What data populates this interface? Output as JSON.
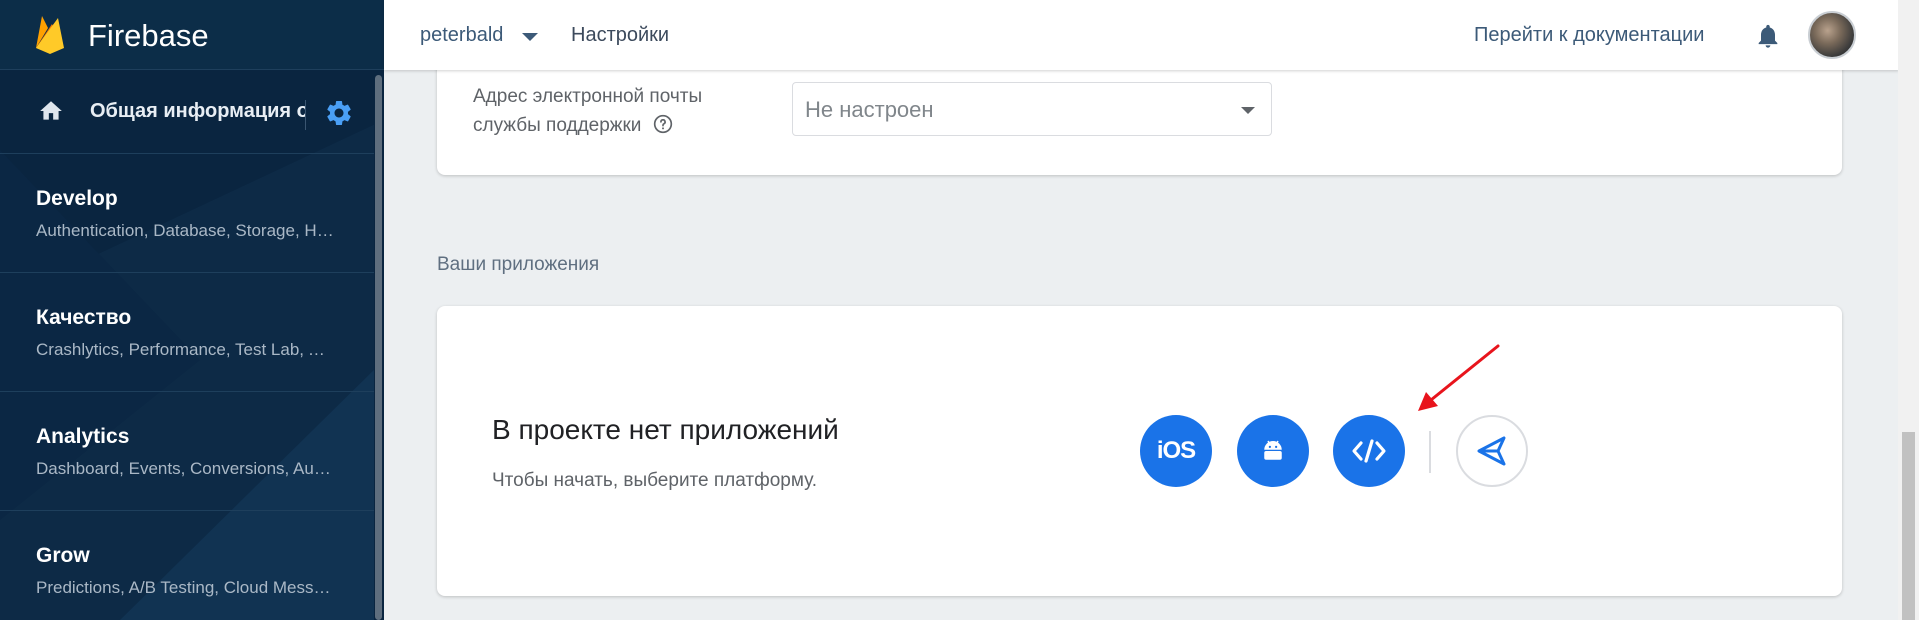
{
  "app": {
    "name": "Firebase"
  },
  "sidebar": {
    "overview_label": "Общая информация о проекте",
    "items": [
      {
        "title": "Develop",
        "subtitle": "Authentication, Database, Storage, Hosting, Functions, ML Kit"
      },
      {
        "title": "Качество",
        "subtitle": "Crashlytics, Performance, Test Lab, App Distribution"
      },
      {
        "title": "Analytics",
        "subtitle": "Dashboard, Events, Conversions, Audiences"
      },
      {
        "title": "Grow",
        "subtitle": "Predictions, A/B Testing, Cloud Messaging"
      }
    ]
  },
  "topbar": {
    "project_name": "peterbald",
    "page_title": "Настройки",
    "docs_link": "Перейти к документации"
  },
  "support": {
    "label": "Адрес электронной почты службы поддержки",
    "value": "Не настроен"
  },
  "apps": {
    "heading": "Ваши приложения",
    "empty_title": "В проекте нет приложений",
    "empty_subtitle": "Чтобы начать, выберите платформу.",
    "platforms": {
      "ios": "iOS",
      "android": "Android",
      "web": "Web",
      "unity": "Unity"
    }
  },
  "colors": {
    "sidebar_bg": "#0a2540",
    "accent": "#1a73e8",
    "annotation_arrow": "#e8141c"
  },
  "icons": [
    "firebase-logo-icon",
    "home-icon",
    "gear-icon",
    "chevron-down-icon",
    "bell-icon",
    "help-icon",
    "android-icon",
    "code-icon",
    "unity-icon"
  ]
}
